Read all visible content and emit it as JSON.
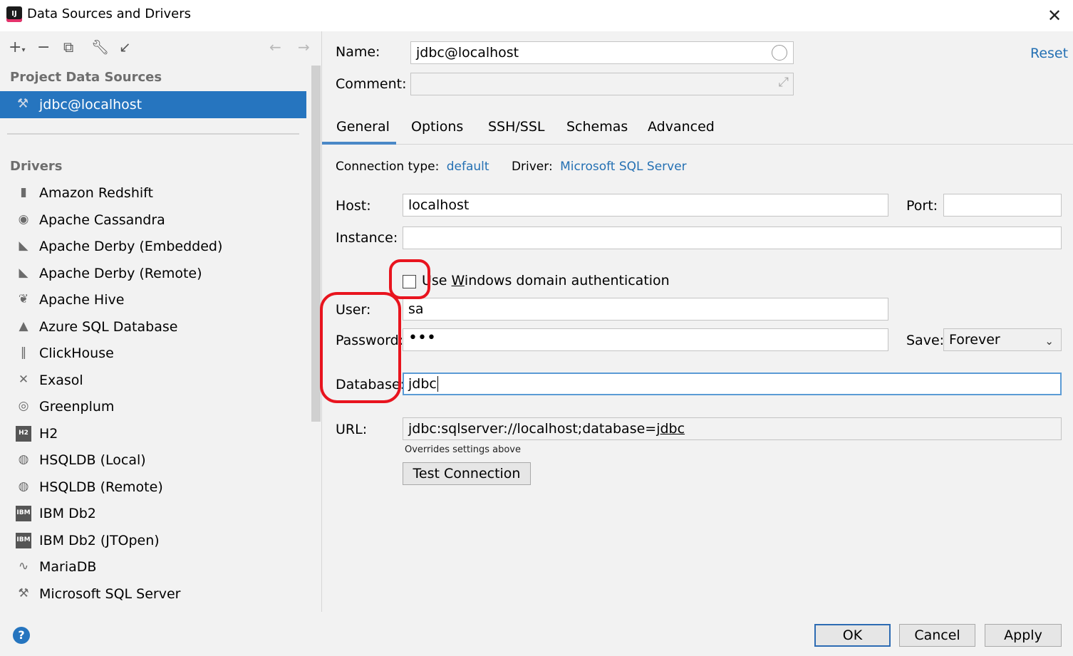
{
  "window": {
    "title": "Data Sources and Drivers",
    "app_icon_text": "IJ"
  },
  "sidebar": {
    "project_header": "Project Data Sources",
    "selected_source": "jdbc@localhost",
    "drivers_header": "Drivers",
    "drivers": [
      {
        "label": "Amazon Redshift",
        "icon": "redshift-icon"
      },
      {
        "label": "Apache Cassandra",
        "icon": "cassandra-icon"
      },
      {
        "label": "Apache Derby (Embedded)",
        "icon": "derby-icon"
      },
      {
        "label": "Apache Derby (Remote)",
        "icon": "derby-icon"
      },
      {
        "label": "Apache Hive",
        "icon": "hive-icon"
      },
      {
        "label": "Azure SQL Database",
        "icon": "azure-icon"
      },
      {
        "label": "ClickHouse",
        "icon": "clickhouse-icon"
      },
      {
        "label": "Exasol",
        "icon": "exasol-icon"
      },
      {
        "label": "Greenplum",
        "icon": "greenplum-icon"
      },
      {
        "label": "H2",
        "icon": "h2-icon"
      },
      {
        "label": "HSQLDB (Local)",
        "icon": "hsqldb-icon"
      },
      {
        "label": "HSQLDB (Remote)",
        "icon": "hsqldb-icon"
      },
      {
        "label": "IBM Db2",
        "icon": "ibm-db2-icon"
      },
      {
        "label": "IBM Db2 (JTOpen)",
        "icon": "ibm-db2-icon"
      },
      {
        "label": "MariaDB",
        "icon": "mariadb-icon"
      },
      {
        "label": "Microsoft SQL Server",
        "icon": "mssql-icon"
      }
    ]
  },
  "form": {
    "name_label": "Name:",
    "name_value": "jdbc@localhost",
    "comment_label": "Comment:",
    "comment_value": "",
    "reset": "Reset",
    "tabs": [
      "General",
      "Options",
      "SSH/SSL",
      "Schemas",
      "Advanced"
    ],
    "active_tab": "General",
    "connection_type_label": "Connection type:",
    "connection_type_value": "default",
    "driver_label": "Driver:",
    "driver_value": "Microsoft SQL Server",
    "host_label": "Host:",
    "host_value": "localhost",
    "port_label": "Port:",
    "port_value": "",
    "instance_label": "Instance:",
    "instance_value": "",
    "windows_auth_label_pre": "Use ",
    "windows_auth_label_key": "W",
    "windows_auth_label_post": "indows domain authentication",
    "windows_auth_checked": false,
    "user_label": "User:",
    "user_value": "sa",
    "password_label": "Password:",
    "password_value": "•••",
    "save_label": "Save:",
    "save_value": "Forever",
    "database_label": "Database:",
    "database_value": "jdbc",
    "url_label": "URL:",
    "url_prefix": "jdbc:sqlserver://localhost;database=",
    "url_db": "jdbc",
    "url_note": "Overrides settings above",
    "test_connection": "Test Connection"
  },
  "footer": {
    "ok": "OK",
    "cancel": "Cancel",
    "apply": "Apply",
    "help": "?"
  },
  "colors": {
    "selection": "#2675bf",
    "link": "#2470b3",
    "annotation": "#e8141e"
  }
}
